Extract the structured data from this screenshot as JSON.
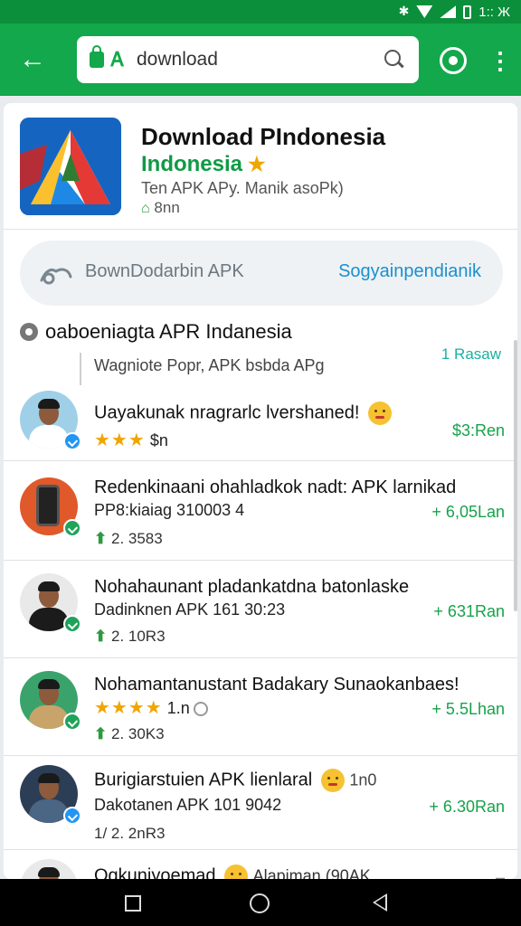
{
  "status_bar": {
    "time": "1:: Ж",
    "bluetooth": "✱"
  },
  "browser": {
    "back_icon": "arrow-left-icon",
    "search_value": "download",
    "site_badge": "Ꭺ",
    "more_icon": "⋮"
  },
  "app": {
    "title": "Download PIndonesia",
    "subtitle": "Indonesia",
    "badge": "★",
    "desc": "Ten APK APy. Manik asoPk)",
    "size": "8nn",
    "home_icon": "⌂"
  },
  "download_bar": {
    "label": "BownDodarbin APK",
    "link": "Sogyainpendianik"
  },
  "section": {
    "title": "oaboeniagta APR Indanesia",
    "count": "1 Rasaw",
    "note": "Wagniote Popr, APK bsbda APg"
  },
  "items": [
    {
      "title": "Uayakunak nragrarlc lvershaned!",
      "line2_stars": "★★★",
      "line2_text": "$n",
      "price": "$3:Ren"
    },
    {
      "title": "Redenkinaani ohahladkok nadt: APK larnikad",
      "line2_text": "PP8:kiaiag 310003 4",
      "line3_up": "⬆",
      "line3_text": "2. 3583",
      "price": "+ 6,05Lan"
    },
    {
      "title": "Nohahaunant pladankatdna batonlaske",
      "line2_text": "Dadinknen APK 161 30:23",
      "line3_up": "⬆",
      "line3_text": "2. 10R3",
      "price": "+ 631Ran"
    },
    {
      "title": "Nohamantanustant Badakary Sunaokanbaes!",
      "line2_stars": "★★★★",
      "line2_text": "1.n",
      "line3_up": "⬆",
      "line3_text": "2. 30K3",
      "price": "+ 5.5Lhan"
    },
    {
      "title": "Burigiarstuien APK lienlaral",
      "title_suffix": "1n0",
      "line2_text": "Dakotanen APK 101 9042",
      "line3_text": "1/ 2. 2nR3",
      "price": "+ 6.30Ran"
    },
    {
      "title": "Ogkuniyoemad",
      "title_suffix": "Alapiman (90AK",
      "price": "–"
    }
  ],
  "colors": {
    "brand_green": "#13a84b",
    "link_blue": "#1c8fd0",
    "price_green": "#16a34a",
    "star": "#f0a500"
  }
}
